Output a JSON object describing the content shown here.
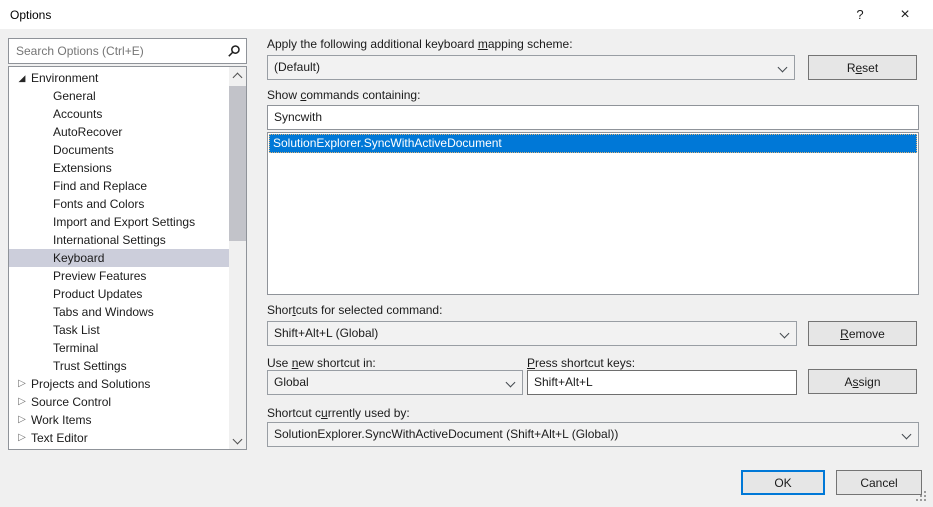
{
  "window": {
    "title": "Options",
    "help_label": "?",
    "close_label": "×"
  },
  "search": {
    "placeholder": "Search Options (Ctrl+E)"
  },
  "icons": {
    "expanded_twisty": "◢",
    "collapsed_twisty": "▷"
  },
  "colors": {
    "selection_blue": "#0078d7",
    "tree_selection": "#cccedb",
    "titlebar_bg": "#ffffff",
    "dialog_bg": "#f0f0f0"
  },
  "sidebar": {
    "items": [
      {
        "label": "Environment",
        "level": 0,
        "state": "expanded",
        "selected": false
      },
      {
        "label": "General",
        "level": 1,
        "state": "none",
        "selected": false
      },
      {
        "label": "Accounts",
        "level": 1,
        "state": "none",
        "selected": false
      },
      {
        "label": "AutoRecover",
        "level": 1,
        "state": "none",
        "selected": false
      },
      {
        "label": "Documents",
        "level": 1,
        "state": "none",
        "selected": false
      },
      {
        "label": "Extensions",
        "level": 1,
        "state": "none",
        "selected": false
      },
      {
        "label": "Find and Replace",
        "level": 1,
        "state": "none",
        "selected": false
      },
      {
        "label": "Fonts and Colors",
        "level": 1,
        "state": "none",
        "selected": false
      },
      {
        "label": "Import and Export Settings",
        "level": 1,
        "state": "none",
        "selected": false
      },
      {
        "label": "International Settings",
        "level": 1,
        "state": "none",
        "selected": false
      },
      {
        "label": "Keyboard",
        "level": 1,
        "state": "none",
        "selected": true
      },
      {
        "label": "Preview Features",
        "level": 1,
        "state": "none",
        "selected": false
      },
      {
        "label": "Product Updates",
        "level": 1,
        "state": "none",
        "selected": false
      },
      {
        "label": "Tabs and Windows",
        "level": 1,
        "state": "none",
        "selected": false
      },
      {
        "label": "Task List",
        "level": 1,
        "state": "none",
        "selected": false
      },
      {
        "label": "Terminal",
        "level": 1,
        "state": "none",
        "selected": false
      },
      {
        "label": "Trust Settings",
        "level": 1,
        "state": "none",
        "selected": false
      },
      {
        "label": "Projects and Solutions",
        "level": 0,
        "state": "collapsed",
        "selected": false
      },
      {
        "label": "Source Control",
        "level": 0,
        "state": "collapsed",
        "selected": false
      },
      {
        "label": "Work Items",
        "level": 0,
        "state": "collapsed",
        "selected": false
      },
      {
        "label": "Text Editor",
        "level": 0,
        "state": "collapsed",
        "selected": false
      }
    ]
  },
  "main": {
    "mapping_scheme": {
      "label": {
        "text": "Apply the following additional keyboard mapping scheme:",
        "u": 40
      },
      "value": "(Default)",
      "reset_button": {
        "text": "Reset",
        "u": 1
      }
    },
    "commands": {
      "label": {
        "text": "Show commands containing:",
        "u": 5
      },
      "value": "Syncwith",
      "results": [
        "SolutionExplorer.SyncWithActiveDocument"
      ],
      "selected_index": 0
    },
    "shortcuts": {
      "label": {
        "text": "Shortcuts for selected command:",
        "u": 4
      },
      "value": "Shift+Alt+L (Global)",
      "remove_button": {
        "text": "Remove",
        "u": 0
      }
    },
    "scope": {
      "label": {
        "text": "Use new shortcut in:",
        "u": 4
      },
      "value": "Global"
    },
    "press_keys": {
      "label": {
        "text": "Press shortcut keys:",
        "u": 0
      },
      "value": "Shift+Alt+L",
      "assign_button": {
        "text": "Assign",
        "u": 1
      }
    },
    "used_by": {
      "label": {
        "text": "Shortcut currently used by:",
        "u": 10
      },
      "value": "SolutionExplorer.SyncWithActiveDocument (Shift+Alt+L (Global))"
    }
  },
  "footer": {
    "ok_label": "OK",
    "cancel_label": "Cancel"
  }
}
